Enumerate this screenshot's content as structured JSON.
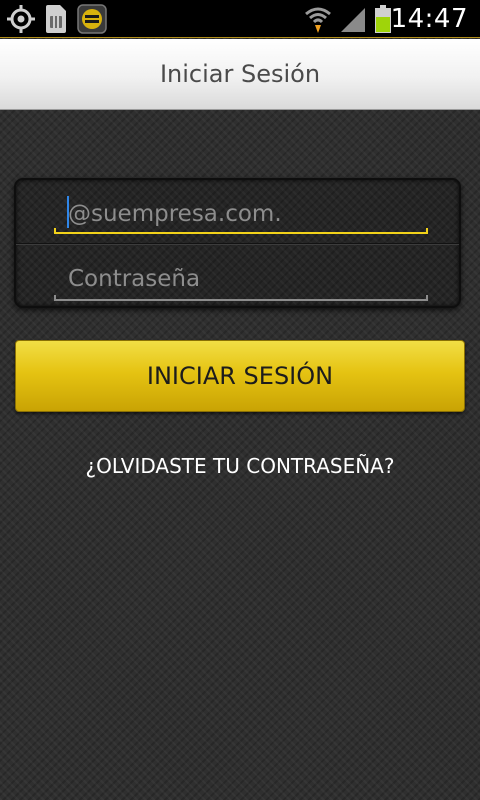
{
  "status_bar": {
    "time": "14:47",
    "icons": [
      "gps-icon",
      "sim-card-icon",
      "app-notification-icon",
      "wifi-icon",
      "signal-icon",
      "battery-icon"
    ],
    "battery_color": "#9fd40a"
  },
  "header": {
    "title": "Iniciar Sesión"
  },
  "login_form": {
    "email": {
      "value": "",
      "placeholder": "@suempresa.com."
    },
    "password": {
      "value": "",
      "placeholder": "Contraseña"
    },
    "submit_label": "INICIAR SESIÓN",
    "forgot_label": "¿OLVIDASTE TU CONTRASEÑA?"
  },
  "colors": {
    "accent": "#e5c312",
    "focus_underline": "#f2d21a",
    "caret": "#2f86e8"
  }
}
